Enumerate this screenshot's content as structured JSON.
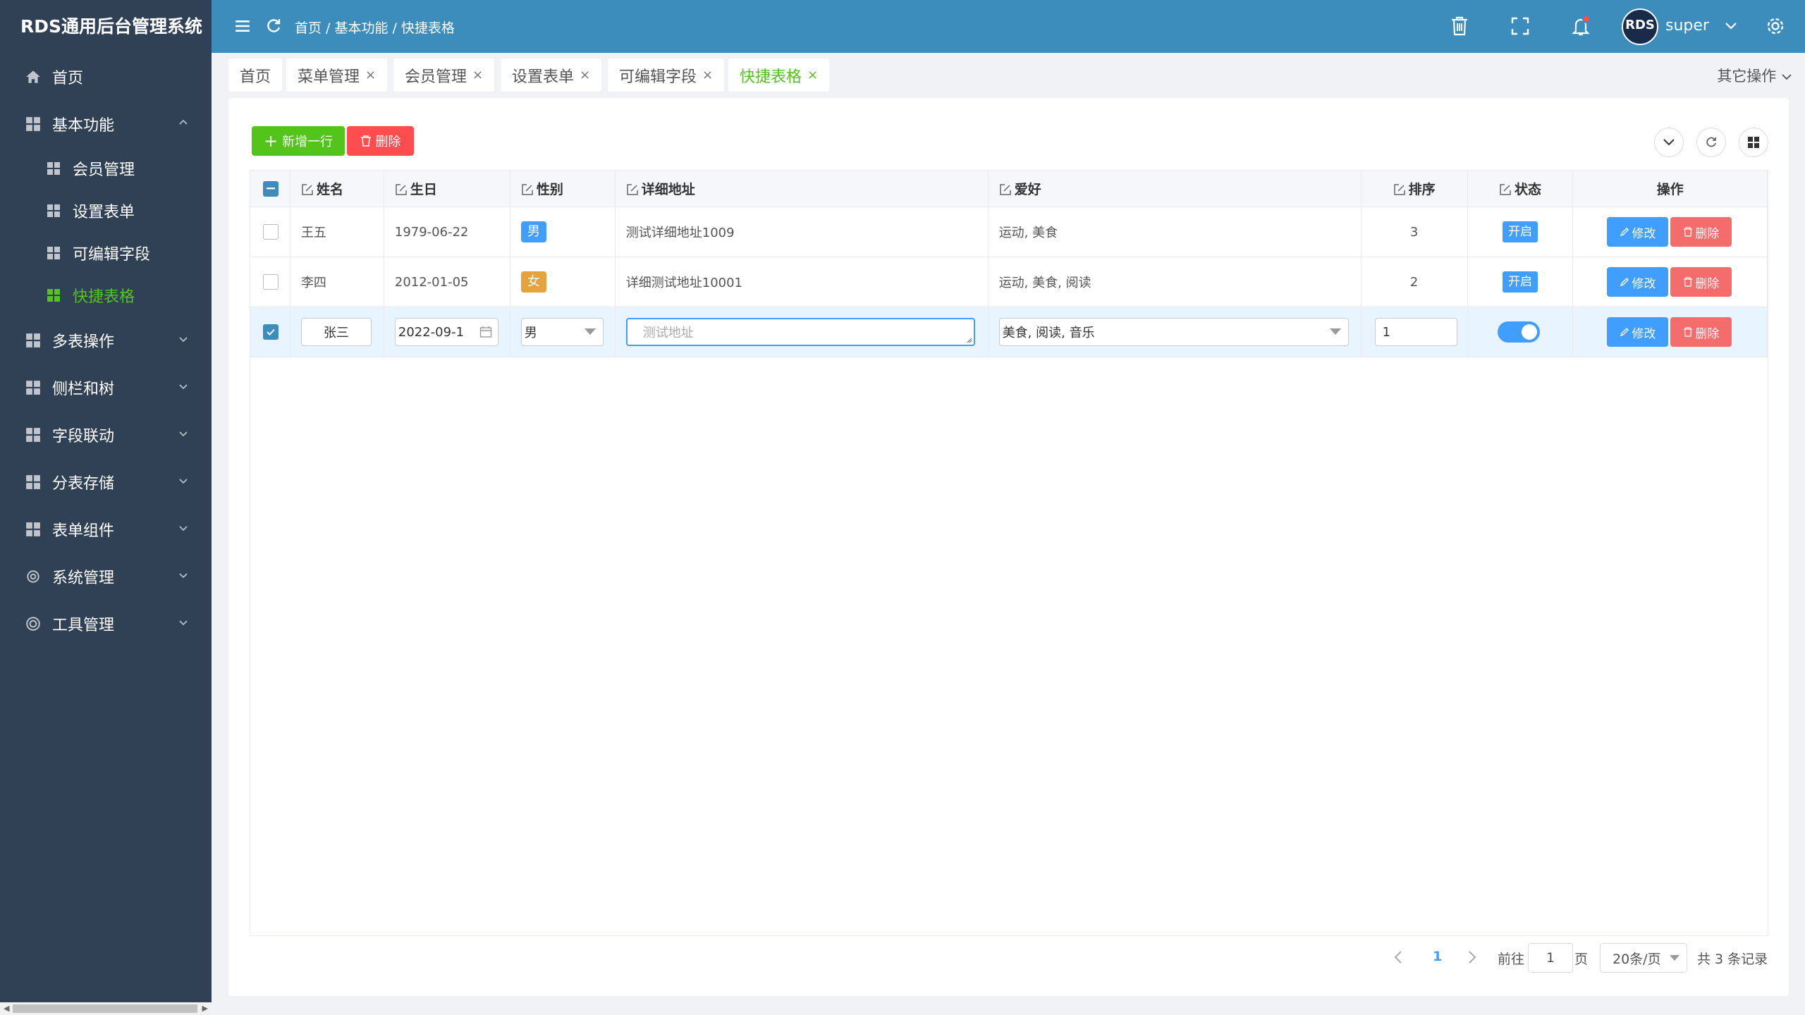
{
  "app": {
    "title": "RDS通用后台管理系统"
  },
  "sidebar": {
    "items": [
      {
        "label": "首页"
      },
      {
        "label": "基本功能",
        "expanded": true,
        "children": [
          {
            "label": "会员管理"
          },
          {
            "label": "设置表单"
          },
          {
            "label": "可编辑字段"
          },
          {
            "label": "快捷表格",
            "active": true
          }
        ]
      },
      {
        "label": "多表操作"
      },
      {
        "label": "侧栏和树"
      },
      {
        "label": "字段联动"
      },
      {
        "label": "分表存储"
      },
      {
        "label": "表单组件"
      },
      {
        "label": "系统管理"
      },
      {
        "label": "工具管理"
      }
    ]
  },
  "header": {
    "breadcrumb": [
      "首页",
      "/ 基本功能",
      "/ 快捷表格"
    ],
    "avatar_text": "RDS",
    "username": "super"
  },
  "tabs": {
    "items": [
      {
        "label": "首页",
        "closable": false
      },
      {
        "label": "菜单管理",
        "closable": true
      },
      {
        "label": "会员管理",
        "closable": true
      },
      {
        "label": "设置表单",
        "closable": true
      },
      {
        "label": "可编辑字段",
        "closable": true
      },
      {
        "label": "快捷表格",
        "closable": true,
        "active": true
      }
    ],
    "close_glyph": "×",
    "other_ops": "其它操作"
  },
  "toolbar": {
    "add_label": "新增一行",
    "delete_label": "删除"
  },
  "table": {
    "columns": [
      "姓名",
      "生日",
      "性别",
      "详细地址",
      "爱好",
      "排序",
      "状态",
      "操作"
    ],
    "rows": [
      {
        "name": "王五",
        "birthday": "1979-06-22",
        "gender": "男",
        "address": "测试详细地址1009",
        "hobby": "运动, 美食",
        "sort": "3",
        "status": "开启",
        "edit": "修改",
        "del": "删除"
      },
      {
        "name": "李四",
        "birthday": "2012-01-05",
        "gender": "女",
        "address": "详细测试地址10001",
        "hobby": "运动, 美食, 阅读",
        "sort": "2",
        "status": "开启",
        "edit": "修改",
        "del": "删除"
      }
    ],
    "editing_row": {
      "name": "张三",
      "birthday": "2022-09-1",
      "gender": "男",
      "address_placeholder": "测试地址",
      "hobby": "美食, 阅读, 音乐",
      "sort": "1",
      "status_on": true,
      "edit": "修改",
      "del": "删除",
      "selected": true
    }
  },
  "pagination": {
    "current_page": "1",
    "goto_label": "前往",
    "goto_value": "1",
    "page_unit": "页",
    "page_size": "20条/页",
    "total": "共 3 条记录"
  },
  "colors": {
    "sidebar_bg": "#304156",
    "header_bg": "#3c8dbc",
    "active_green": "#52c41a",
    "primary_blue": "#409eff",
    "danger_red": "#f56c6c",
    "female_tag": "#e6a23c"
  }
}
